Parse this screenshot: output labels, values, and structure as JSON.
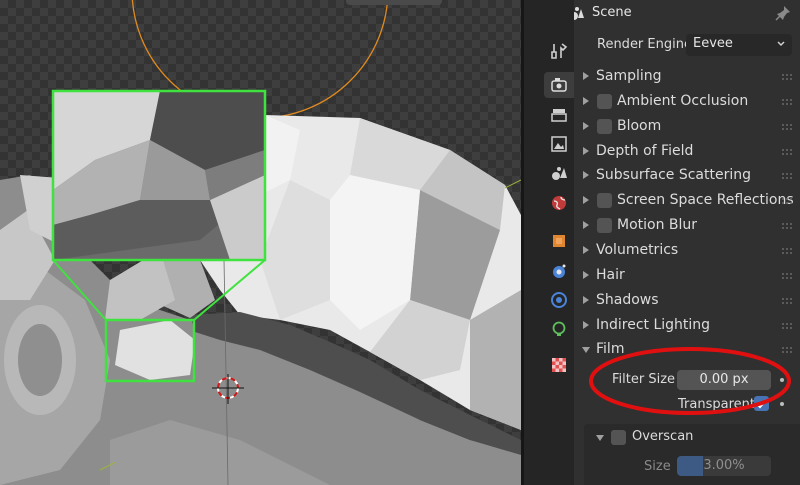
{
  "header": {
    "title": "Scene"
  },
  "render_engine": {
    "label": "Render Engine",
    "value": "Eevee"
  },
  "panels": [
    {
      "title": "Sampling",
      "checkbox": false,
      "expanded": false
    },
    {
      "title": "Ambient Occlusion",
      "checkbox": true,
      "expanded": false
    },
    {
      "title": "Bloom",
      "checkbox": true,
      "expanded": false
    },
    {
      "title": "Depth of Field",
      "checkbox": false,
      "expanded": false
    },
    {
      "title": "Subsurface Scattering",
      "checkbox": false,
      "expanded": false
    },
    {
      "title": "Screen Space Reflections",
      "checkbox": true,
      "expanded": false
    },
    {
      "title": "Motion Blur",
      "checkbox": true,
      "expanded": false
    },
    {
      "title": "Volumetrics",
      "checkbox": false,
      "expanded": false
    },
    {
      "title": "Hair",
      "checkbox": false,
      "expanded": false
    },
    {
      "title": "Shadows",
      "checkbox": false,
      "expanded": false
    },
    {
      "title": "Indirect Lighting",
      "checkbox": false,
      "expanded": false
    },
    {
      "title": "Film",
      "checkbox": false,
      "expanded": true
    }
  ],
  "film": {
    "filter_size_label": "Filter Size",
    "filter_size_value": "0.00 px",
    "transparent_label": "Transparent",
    "transparent_checked": true,
    "overscan_label": "Overscan",
    "overscan_checked": false,
    "size_label": "Size",
    "size_value": "3.00%",
    "size_fraction": 0.03
  },
  "tabs": [
    "tool-icon",
    "render-icon",
    "output-icon",
    "view-layer-icon",
    "scene-icon",
    "world-icon",
    "object-icon",
    "modifier-icon",
    "particles-icon",
    "physics-icon",
    "constraints-icon",
    "texture-icon"
  ],
  "colors": {
    "accent": "#4772b3",
    "highlight_box": "#3fe23f",
    "annotation": "#e01010",
    "light_circle": "#e08a1e"
  }
}
